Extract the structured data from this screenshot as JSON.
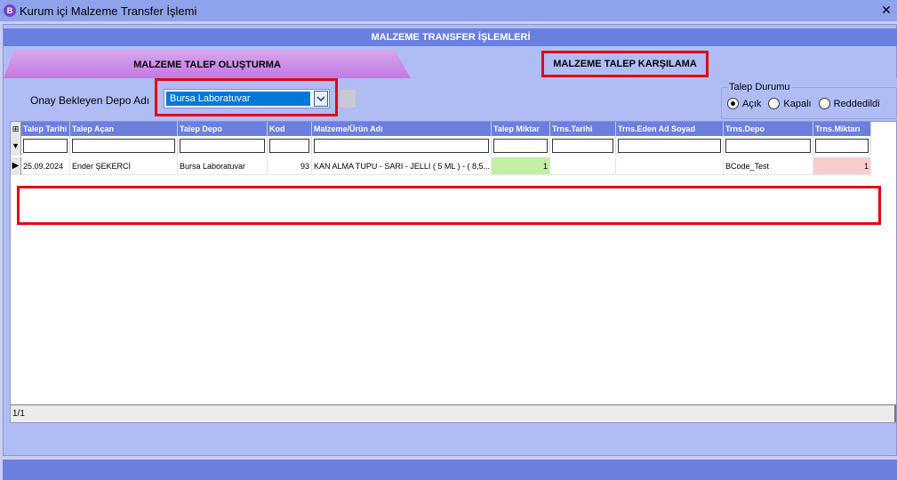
{
  "window": {
    "title": "Kurum içi Malzeme Transfer İşlemi",
    "app_icon": "B",
    "close": "✕"
  },
  "section_title": "MALZEME TRANSFER İŞLEMLERİ",
  "tabs": {
    "create": "MALZEME TALEP OLUŞTURMA",
    "accept": "MALZEME TALEP KARŞILAMA"
  },
  "depo": {
    "label": "Onay Bekleyen Depo Adı",
    "selected": "Bursa Laboratuvar"
  },
  "status": {
    "legend": "Talep Durumu",
    "options": [
      "Açık",
      "Kapalı",
      "Reddedildi"
    ],
    "selected_index": 0
  },
  "grid": {
    "columns": [
      "Talep Tarihi",
      "Talep Açan",
      "Talep Depo",
      "Kod",
      "Malzeme/Ürün Adı",
      "Talep Miktar",
      "Trns.Tarihi",
      "Trns.Eden Ad Soyad",
      "Trns.Depo",
      "Trns.Miktarı"
    ],
    "rows": [
      {
        "talep_tarihi": "25.09.2024",
        "talep_acan": "Ender ŞEKERCİ",
        "talep_depo": "Bursa Laboratuvar",
        "kod": "93",
        "malzeme": "KAN ALMA TUPU - SARI - JELLI  ( 5 ML ) - ( 8,5...",
        "talep_miktar": "1",
        "trns_tarihi": "",
        "trns_eden": "",
        "trns_depo": "BCode_Test",
        "trns_miktari": "1"
      }
    ],
    "footer": "1/1"
  },
  "colors": {
    "header": "#6a7fe0",
    "panel": "#b0bdf5",
    "highlight": "#e30613",
    "green_cell": "#c1f0a3",
    "pink_cell": "#f8cdd0"
  }
}
